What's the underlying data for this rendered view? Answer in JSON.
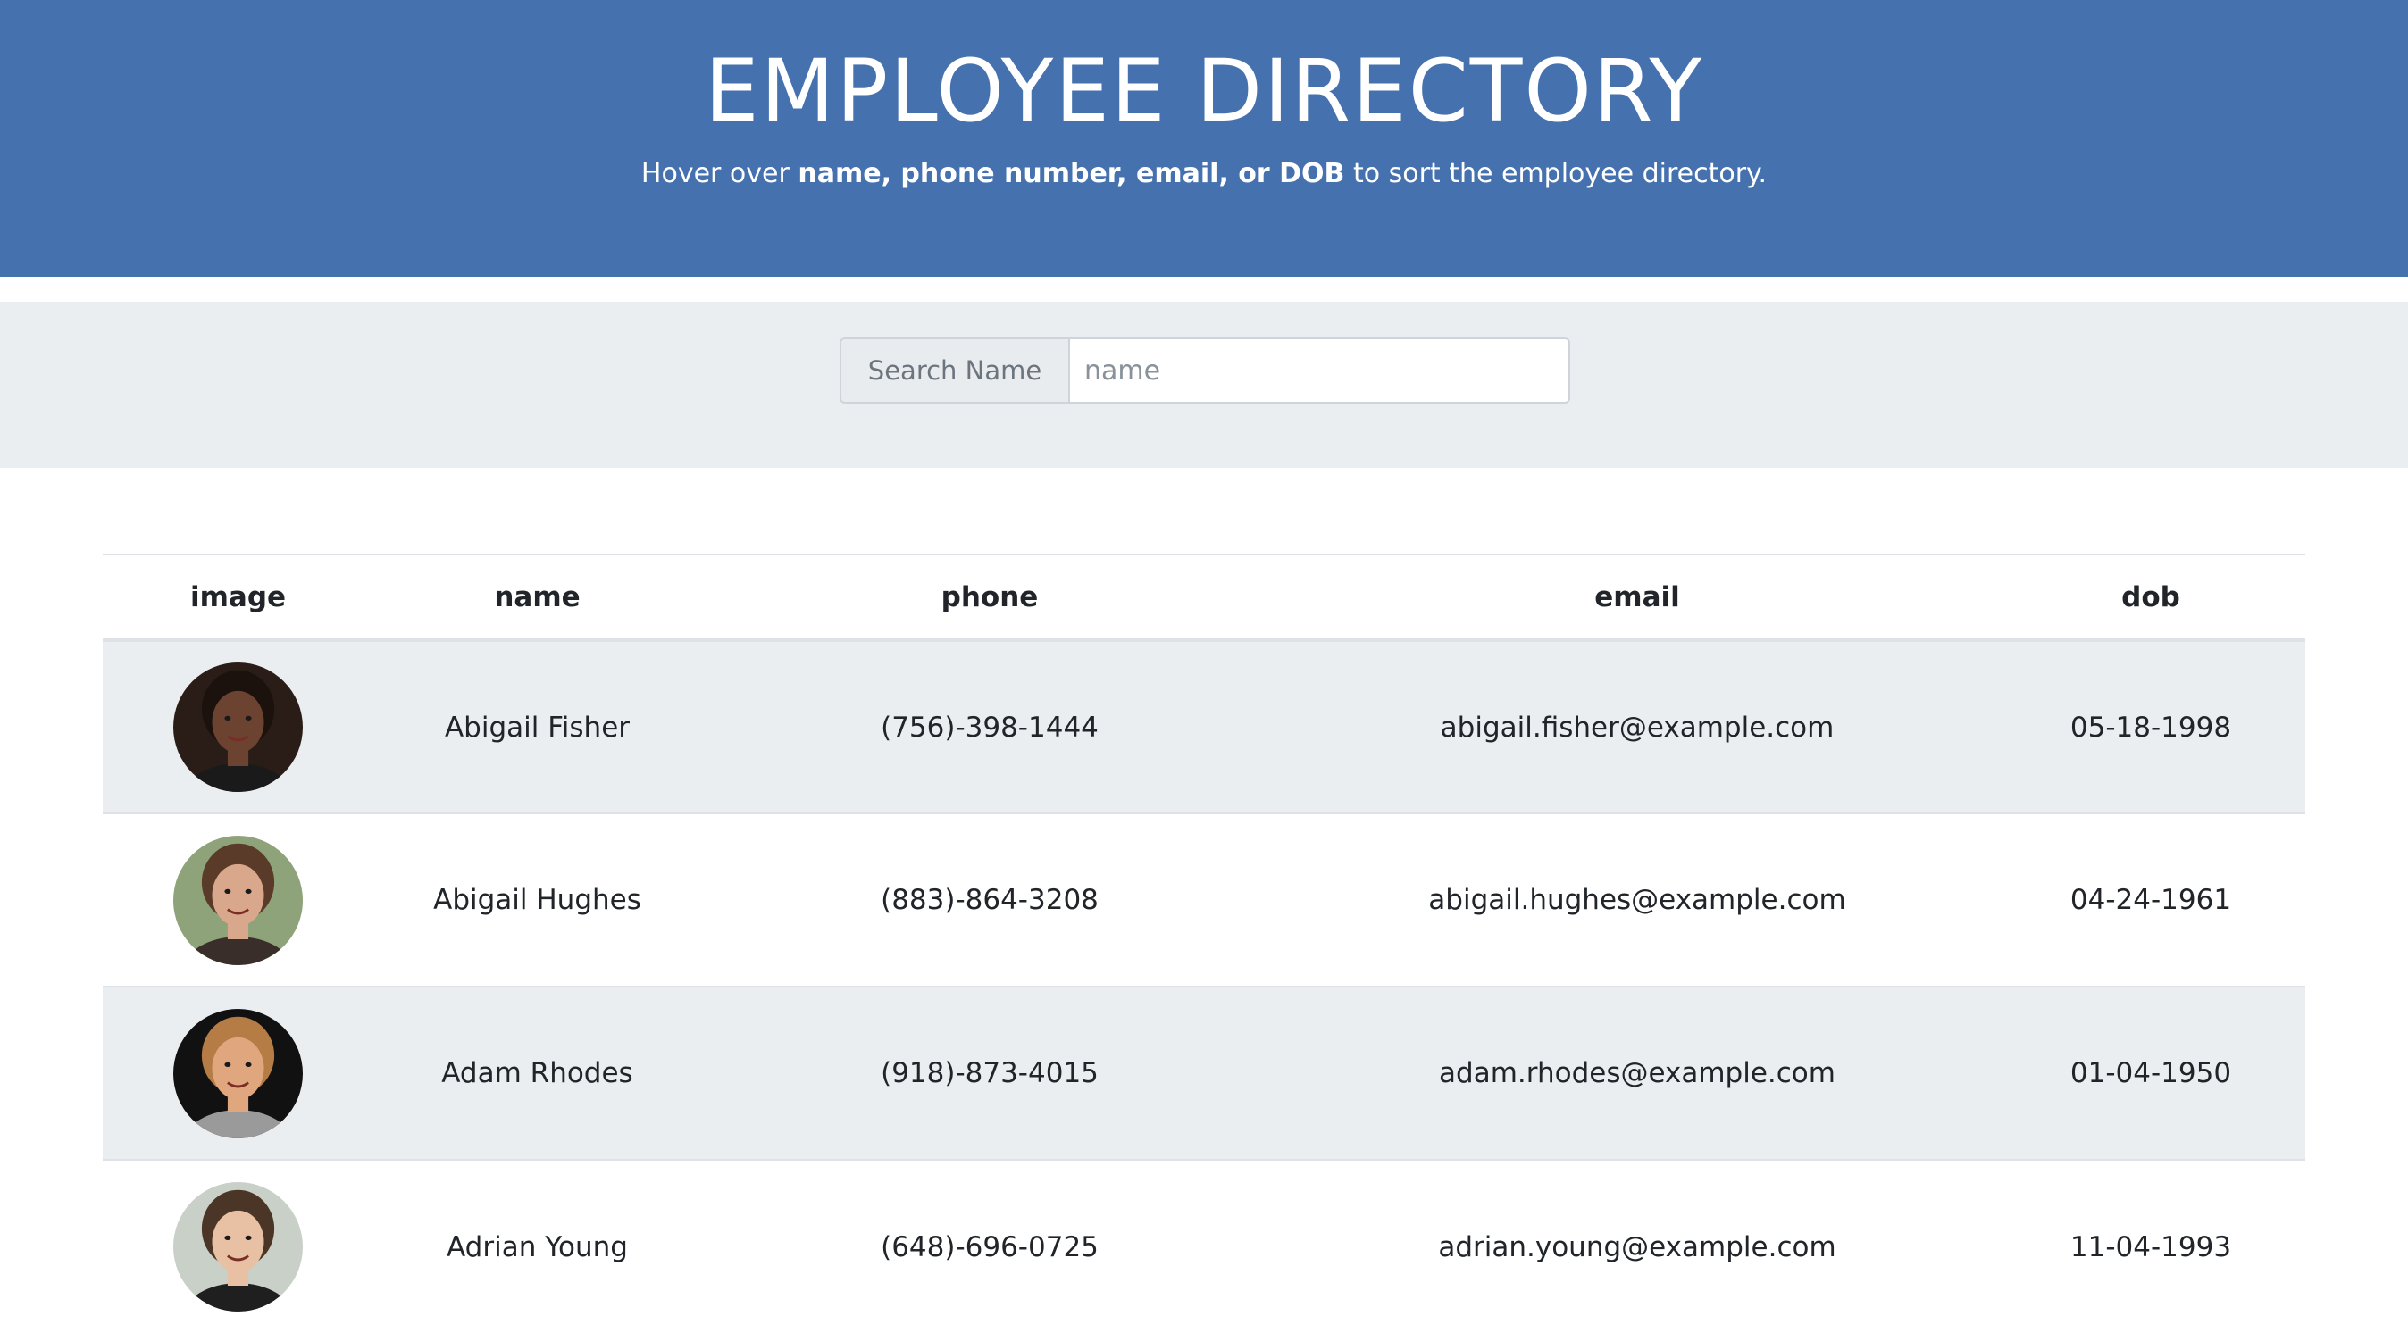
{
  "header": {
    "title": "EMPLOYEE DIRECTORY",
    "subtitle_prefix": "Hover over ",
    "subtitle_bold": "name, phone number, email, or DOB",
    "subtitle_suffix": " to sort the employee directory."
  },
  "search": {
    "label": "Search Name",
    "placeholder": "name",
    "value": ""
  },
  "table": {
    "columns": [
      "image",
      "name",
      "phone",
      "email",
      "dob"
    ],
    "rows": [
      {
        "avatar": {
          "skin": "#6b4330",
          "hair": "#1c120d",
          "bg": "#2a1d17",
          "shirt": "#1a1a1a"
        },
        "name": "Abigail Fisher",
        "phone": "(756)-398-1444",
        "email": "abigail.fisher@example.com",
        "dob": "05-18-1998"
      },
      {
        "avatar": {
          "skin": "#d9a88c",
          "hair": "#5a3a28",
          "bg": "#8fa37a",
          "shirt": "#3a2e2a"
        },
        "name": "Abigail Hughes",
        "phone": "(883)-864-3208",
        "email": "abigail.hughes@example.com",
        "dob": "04-24-1961"
      },
      {
        "avatar": {
          "skin": "#e0a77f",
          "hair": "#b57d45",
          "bg": "#111111",
          "shirt": "#9a9a9a"
        },
        "name": "Adam Rhodes",
        "phone": "(918)-873-4015",
        "email": "adam.rhodes@example.com",
        "dob": "01-04-1950"
      },
      {
        "avatar": {
          "skin": "#e8c0a4",
          "hair": "#4a3526",
          "bg": "#c9d0c8",
          "shirt": "#1f1f1f"
        },
        "name": "Adrian Young",
        "phone": "(648)-696-0725",
        "email": "adrian.young@example.com",
        "dob": "11-04-1993"
      }
    ]
  }
}
